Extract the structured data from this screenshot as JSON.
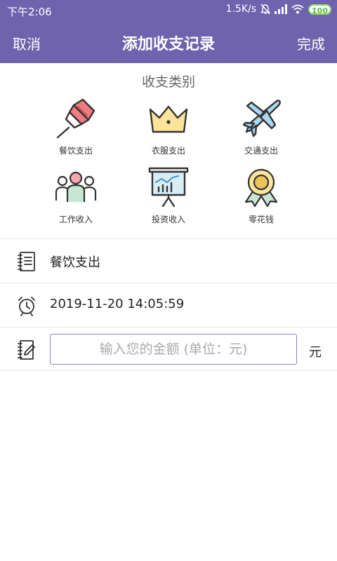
{
  "status_bar": {
    "time": "下午2:06",
    "speed": "1.5K/s",
    "battery": "100",
    "icons": [
      "mute-icon",
      "signal-icon",
      "wifi-icon",
      "battery-icon"
    ]
  },
  "header": {
    "cancel": "取消",
    "title": "添加收支记录",
    "done": "完成"
  },
  "category_section": {
    "title": "收支类别",
    "items": [
      {
        "label": "餐饮支出",
        "icon": "pushpin-icon"
      },
      {
        "label": "衣服支出",
        "icon": "crown-icon"
      },
      {
        "label": "交通支出",
        "icon": "airplane-icon"
      },
      {
        "label": "工作收入",
        "icon": "people-icon"
      },
      {
        "label": "投资收入",
        "icon": "chart-board-icon"
      },
      {
        "label": "零花钱",
        "icon": "medal-icon"
      }
    ]
  },
  "form": {
    "category_value": "餐饮支出",
    "datetime_value": "2019-11-20 14:05:59",
    "amount_placeholder": "输入您的金额 (单位：元)",
    "amount_value": "",
    "unit": "元"
  },
  "colors": {
    "primary": "#6f63ad",
    "accent_red": "#f07b82",
    "accent_yellow": "#fbe39a",
    "accent_blue": "#a9d8ef",
    "accent_green": "#c8e6d4"
  }
}
